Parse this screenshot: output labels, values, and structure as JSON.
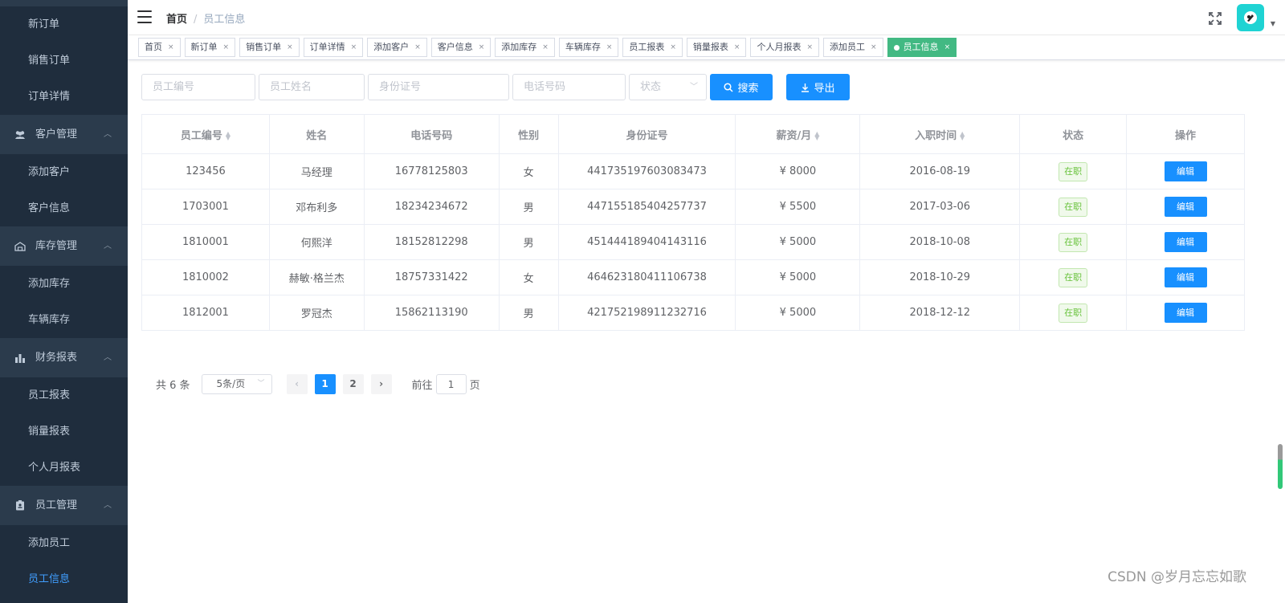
{
  "sidebar": {
    "top_items": [
      "新订单",
      "销售订单",
      "订单详情"
    ],
    "groups": [
      {
        "label": "客户管理",
        "icon": "users-icon",
        "items": [
          "添加客户",
          "客户信息"
        ]
      },
      {
        "label": "库存管理",
        "icon": "warehouse-icon",
        "items": [
          "添加库存",
          "车辆库存"
        ]
      },
      {
        "label": "财务报表",
        "icon": "bar-chart-icon",
        "items": [
          "员工报表",
          "销量报表",
          "个人月报表"
        ]
      },
      {
        "label": "员工管理",
        "icon": "badge-icon",
        "items": [
          "添加员工",
          "员工信息"
        ]
      }
    ],
    "active_item": "员工信息"
  },
  "header": {
    "breadcrumb_home": "首页",
    "breadcrumb_separator": "/",
    "breadcrumb_current": "员工信息"
  },
  "tags": [
    {
      "label": "首页",
      "active": false
    },
    {
      "label": "新订单",
      "active": false
    },
    {
      "label": "销售订单",
      "active": false
    },
    {
      "label": "订单详情",
      "active": false
    },
    {
      "label": "添加客户",
      "active": false
    },
    {
      "label": "客户信息",
      "active": false
    },
    {
      "label": "添加库存",
      "active": false
    },
    {
      "label": "车辆库存",
      "active": false
    },
    {
      "label": "员工报表",
      "active": false
    },
    {
      "label": "销量报表",
      "active": false
    },
    {
      "label": "个人月报表",
      "active": false
    },
    {
      "label": "添加员工",
      "active": false
    },
    {
      "label": "员工信息",
      "active": true
    }
  ],
  "filter": {
    "employee_id_placeholder": "员工编号",
    "name_placeholder": "员工姓名",
    "id_card_placeholder": "身份证号",
    "phone_placeholder": "电话号码",
    "status_placeholder": "状态",
    "search_label": "搜索",
    "export_label": "导出"
  },
  "table": {
    "headers": [
      "员工编号",
      "姓名",
      "电话号码",
      "性别",
      "身份证号",
      "薪资/月",
      "入职时间",
      "状态",
      "操作"
    ],
    "rows": [
      {
        "id": "123456",
        "name": "马经理",
        "phone": "16778125803",
        "gender": "女",
        "id_card": "441735197603083473",
        "salary": "¥ 8000",
        "hire_date": "2016-08-19",
        "status": "在职",
        "action": "编辑"
      },
      {
        "id": "1703001",
        "name": "邓布利多",
        "phone": "18234234672",
        "gender": "男",
        "id_card": "447155185404257737",
        "salary": "¥ 5500",
        "hire_date": "2017-03-06",
        "status": "在职",
        "action": "编辑"
      },
      {
        "id": "1810001",
        "name": "何熙洋",
        "phone": "18152812298",
        "gender": "男",
        "id_card": "451444189404143116",
        "salary": "¥ 5000",
        "hire_date": "2018-10-08",
        "status": "在职",
        "action": "编辑"
      },
      {
        "id": "1810002",
        "name": "赫敏·格兰杰",
        "phone": "18757331422",
        "gender": "女",
        "id_card": "464623180411106738",
        "salary": "¥ 5000",
        "hire_date": "2018-10-29",
        "status": "在职",
        "action": "编辑"
      },
      {
        "id": "1812001",
        "name": "罗冠杰",
        "phone": "15862113190",
        "gender": "男",
        "id_card": "421752198911232716",
        "salary": "¥ 5000",
        "hire_date": "2018-12-12",
        "status": "在职",
        "action": "编辑"
      }
    ]
  },
  "pagination": {
    "total_text": "共 6 条",
    "page_size": "5条/页",
    "pages": [
      "1",
      "2"
    ],
    "current_page": "1",
    "goto_label": "前往",
    "goto_value": "1",
    "page_suffix": "页"
  },
  "watermark": "CSDN @岁月忘忘如歌",
  "colors": {
    "sidebar_bg": "#1f2d3d",
    "primary": "#1890ff",
    "active_tag": "#42b983",
    "success": "#67c23a",
    "avatar": "#1fd3d3"
  }
}
